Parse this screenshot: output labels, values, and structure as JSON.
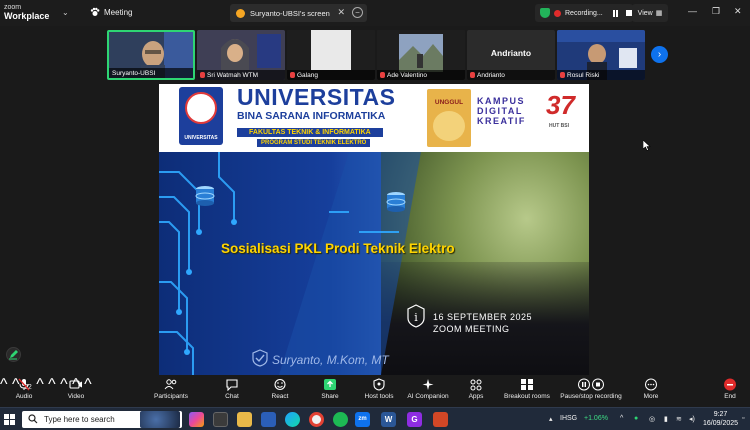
{
  "app": {
    "brand_line1": "zoom",
    "brand_line2": "Workplace",
    "meeting_label": "Meeting"
  },
  "share_tab": {
    "title": "Suryanto-UBSI's screen",
    "close_symbol": "✕",
    "minimize_symbol": "−"
  },
  "recording": {
    "label": "Recording...",
    "view_label": "View"
  },
  "participants": [
    {
      "name": "Suryanto-UBSI",
      "active": true,
      "muted": false
    },
    {
      "name": "Sri Watmah WTM",
      "active": false,
      "muted": true
    },
    {
      "name": "Galang",
      "active": false,
      "muted": true
    },
    {
      "name": "Ade Valentino",
      "active": false,
      "muted": true
    },
    {
      "name": "Andrianto",
      "active": false,
      "muted": true,
      "name_only": "Andrianto"
    },
    {
      "name": "Rosul Riski",
      "active": false,
      "muted": true
    }
  ],
  "slide": {
    "header_title": "UNIVERSITAS",
    "header_subtitle": "BINA SARANA INFORMATIKA",
    "faculty": "FAKULTAS TEKNIK & INFORMATIKA",
    "program": "PROGRAM STUDI TEKNIK ELEKTRO",
    "logo_caption": "UNIVERSITAS",
    "cert_label": "UNGGUL",
    "kampus_lines": [
      "KAMPUS",
      "DIGITAL",
      "KREATIF"
    ],
    "anniversary_number": "37",
    "anniversary_caption": "HUT BSI",
    "main_title": "Sosialisasi PKL Prodi Teknik Elektro",
    "date": "16 SEPTEMBER 2025",
    "venue": "ZOOM MEETING",
    "presenter": "Suryanto, M.Kom, MT"
  },
  "toolbar": {
    "audio": "Audio",
    "video": "Video",
    "participants": "Participants",
    "participants_count": "32",
    "chat": "Chat",
    "react": "React",
    "share": "Share",
    "host_tools": "Host tools",
    "ai_companion": "AI Companion",
    "apps": "Apps",
    "breakout_rooms": "Breakout rooms",
    "pause_recording": "Pause/stop recording",
    "more": "More",
    "end": "End"
  },
  "taskbar": {
    "search_placeholder": "Type here to search",
    "stock_ticker": "IHSG",
    "stock_change": "+1.06%",
    "time": "9:27",
    "date": "16/09/2025"
  },
  "colors": {
    "zoom_blue": "#0e72ed",
    "active_green": "#2ed573",
    "recording_red": "#e02b2b",
    "ubsi_blue": "#1d3f9c",
    "title_yellow": "#ffd400",
    "stock_green": "#3ddc84"
  }
}
